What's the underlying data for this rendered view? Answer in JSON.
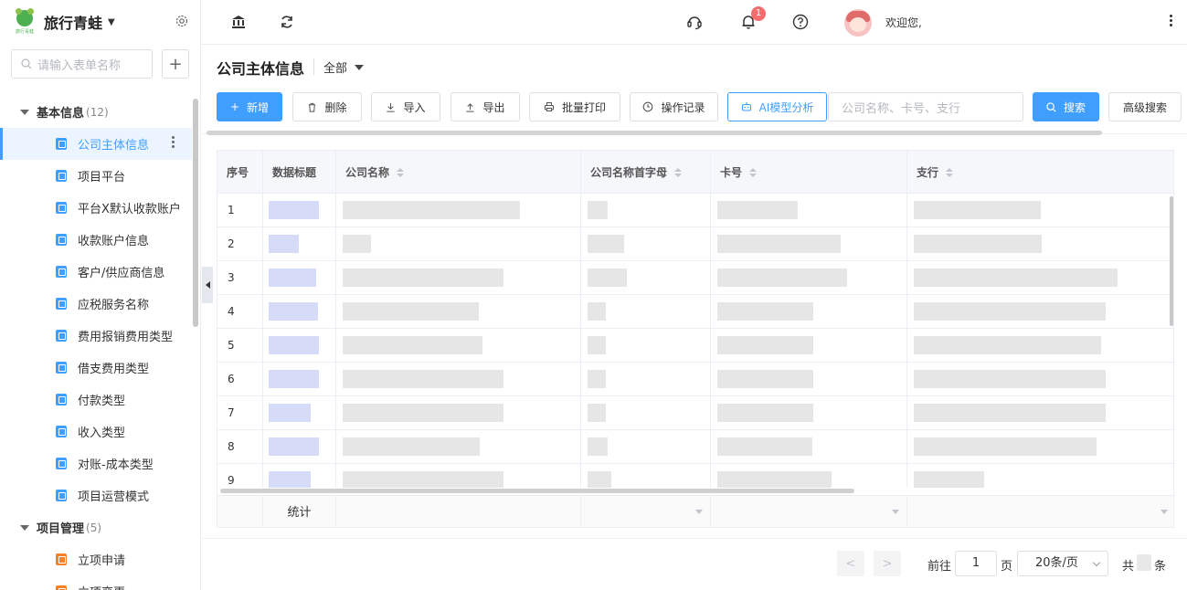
{
  "sidebar": {
    "brand_name": "旅行青蛙",
    "logo_text": "旅行青蛙",
    "search_placeholder": "请输入表单名称",
    "add_label": "+",
    "groups": [
      {
        "label": "基本信息",
        "count": "(12)",
        "items": [
          {
            "label": "公司主体信息",
            "active": true
          },
          {
            "label": "项目平台"
          },
          {
            "label": "平台X默认收款账户"
          },
          {
            "label": "收款账户信息"
          },
          {
            "label": "客户/供应商信息"
          },
          {
            "label": "应税服务名称"
          },
          {
            "label": "费用报销费用类型"
          },
          {
            "label": "借支费用类型"
          },
          {
            "label": "付款类型"
          },
          {
            "label": "收入类型"
          },
          {
            "label": "对账-成本类型"
          },
          {
            "label": "项目运营模式"
          }
        ]
      },
      {
        "label": "项目管理",
        "count": "(5)",
        "items": [
          {
            "label": "立项申请"
          },
          {
            "label": "立项变更"
          }
        ]
      }
    ]
  },
  "topbar": {
    "notification_count": "1",
    "welcome": "欢迎您,"
  },
  "page": {
    "title": "公司主体信息",
    "scope": "全部"
  },
  "toolbar": {
    "add": "新增",
    "delete": "删除",
    "import": "导入",
    "export": "导出",
    "batch_print": "批量打印",
    "op_log": "操作记录",
    "ai_analysis": "AI模型分析",
    "search_placeholder": "公司名称、卡号、支行",
    "search": "搜索",
    "advanced_search": "高级搜索"
  },
  "table": {
    "columns": [
      "序号",
      "数据标题",
      "公司名称",
      "公司名称首字母",
      "卡号",
      "支行"
    ],
    "row_numbers": [
      "1",
      "2",
      "3",
      "4",
      "5",
      "6",
      "7",
      "8",
      "9"
    ],
    "footer_label": "统计"
  },
  "pagination": {
    "prev": "<",
    "next": ">",
    "goto_prefix": "前往",
    "page": "1",
    "goto_suffix": "页",
    "page_size": "20条/页",
    "total_prefix": "共",
    "total_suffix": "条"
  },
  "colors": {
    "primary": "#409eff",
    "danger_badge": "#f56c6c",
    "active_bg": "#ecf5ff",
    "redacted": "#e6e6e6",
    "redacted_title": "#d6dcf8"
  },
  "icons": [
    "gear-icon",
    "search-icon",
    "bank-icon",
    "refresh-icon",
    "headset-icon",
    "bell-icon",
    "help-icon",
    "plus-icon",
    "trash-icon",
    "download-icon",
    "upload-icon",
    "printer-icon",
    "clock-icon"
  ]
}
